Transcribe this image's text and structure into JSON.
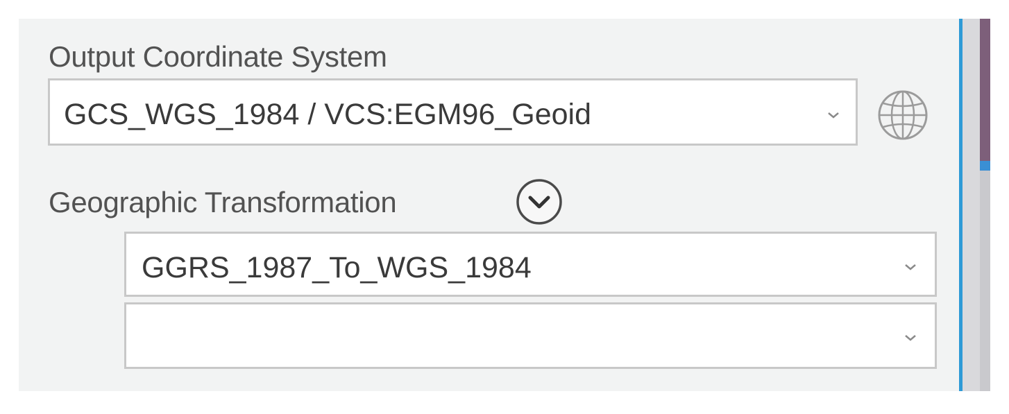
{
  "output_coordinate_system": {
    "label": "Output Coordinate System",
    "value": "GCS_WGS_1984 / VCS:EGM96_Geoid",
    "dropdown_icon": "chevron-down-icon",
    "globe_icon": "globe-icon"
  },
  "geographic_transformation": {
    "label": "Geographic Transformation",
    "expand_icon": "circle-chevron-down-icon",
    "transformations": [
      {
        "value": "GGRS_1987_To_WGS_1984"
      },
      {
        "value": ""
      }
    ]
  },
  "colors": {
    "panel_background": "#f2f3f3",
    "accent_divider": "#2e9ad6",
    "label_text": "#525252",
    "field_border": "#c8c8c8"
  }
}
